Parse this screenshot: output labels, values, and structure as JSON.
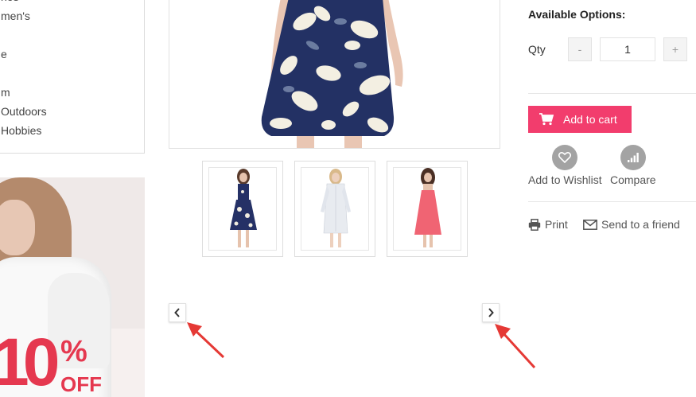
{
  "sidebar": {
    "categories": [
      "hes",
      "men's",
      "e",
      "m",
      "Outdoors",
      "Hobbies"
    ]
  },
  "banner": {
    "big_text": "10",
    "percent": "%",
    "off": "OFF"
  },
  "options": {
    "title": "Available Options:",
    "qty_label": "Qty",
    "minus": "-",
    "qty_value": "1",
    "plus": "+"
  },
  "actions": {
    "add_to_cart": "Add to cart",
    "wishlist": "Add to Wishlist",
    "compare": "Compare",
    "print": "Print",
    "send": "Send to a friend"
  },
  "colors": {
    "accent": "#f23d6d",
    "annotation": "#e53935",
    "icon_gray": "#a3a3a3"
  }
}
